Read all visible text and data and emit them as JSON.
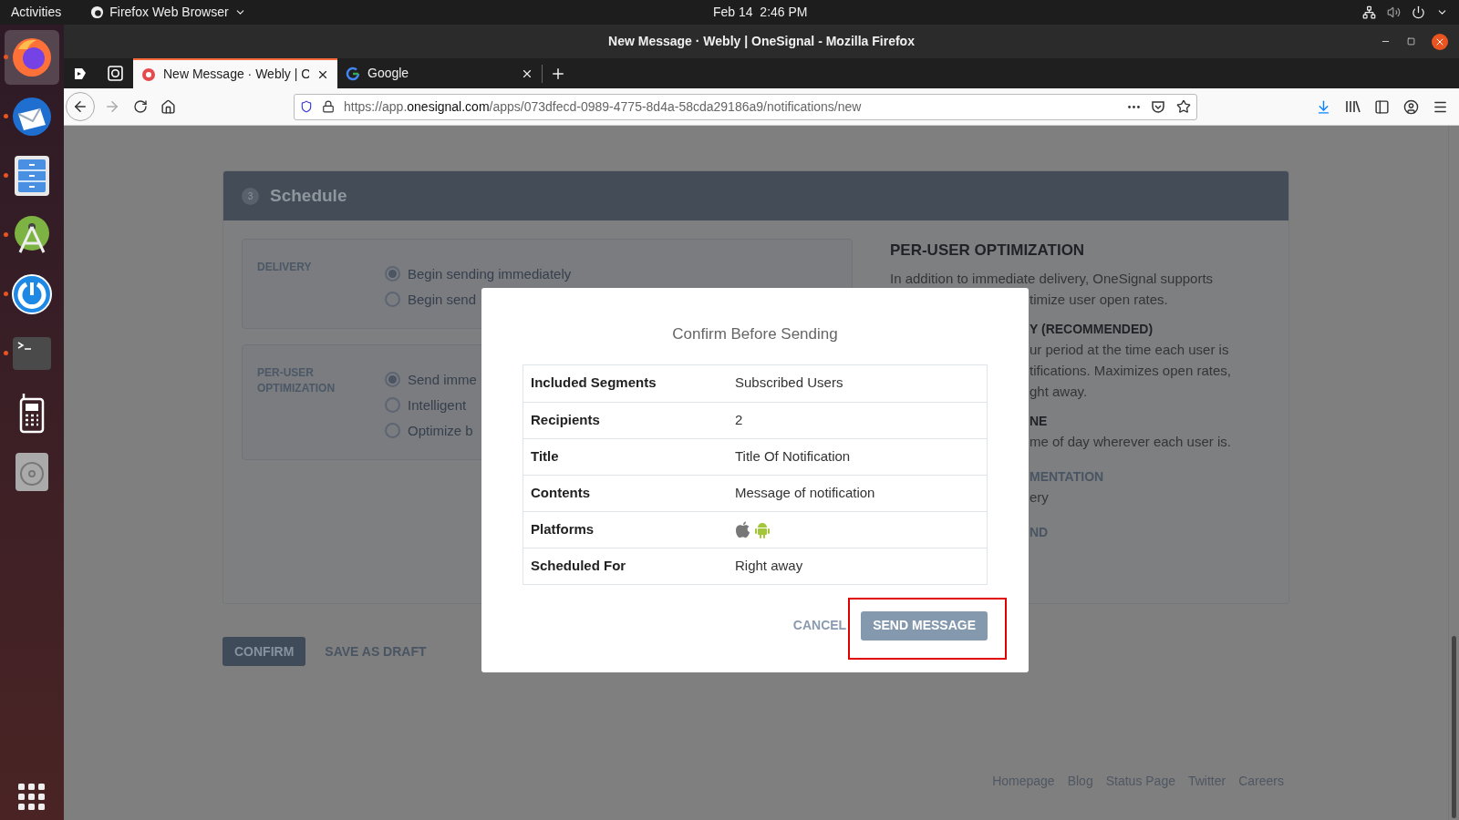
{
  "top_bar": {
    "activities": "Activities",
    "app_menu": "Firefox Web Browser",
    "clock": "Feb 14  2:46 PM"
  },
  "dock": [
    {
      "kind": "firefox",
      "running": true,
      "selected": true
    },
    {
      "kind": "mail",
      "running": true,
      "selected": false
    },
    {
      "kind": "files",
      "running": true,
      "selected": false
    },
    {
      "kind": "studio",
      "running": true,
      "selected": false
    },
    {
      "kind": "chat",
      "running": true,
      "selected": false
    },
    {
      "kind": "terminal",
      "running": true,
      "selected": false
    },
    {
      "kind": "phone",
      "running": false,
      "selected": false
    },
    {
      "kind": "disc",
      "running": false,
      "selected": false
    }
  ],
  "window": {
    "title": "New Message · Webly | OneSignal - Mozilla Firefox"
  },
  "tabs": [
    {
      "kind": "onesignal",
      "label": "New Message · Webly | O",
      "selected": true
    },
    {
      "kind": "google",
      "label": "Google",
      "selected": false
    }
  ],
  "address_bar": {
    "prefix": "https://app.",
    "domain": "onesignal.com",
    "path": "/apps/073dfecd-0989-4775-8d4a-58cda29186a9/notifications/new"
  },
  "schedule": {
    "step": "3",
    "title": "Schedule",
    "sections": [
      {
        "label": "DELIVERY",
        "options": [
          {
            "label": "Begin sending immediately",
            "selected": true
          },
          {
            "label": "Begin send",
            "selected": false
          }
        ]
      },
      {
        "label": "PER-USER OPTIMIZATION",
        "options": [
          {
            "label": "Send imme",
            "selected": true
          },
          {
            "label": "Intelligent",
            "selected": false
          },
          {
            "label": "Optimize b",
            "selected": false
          }
        ]
      }
    ]
  },
  "info_panel": {
    "heading": "PER-USER OPTIMIZATION",
    "intro": "In addition to immediate delivery, OneSignal supports",
    "fragments": [
      {
        "kind": "text",
        "text": "timize user open rates."
      },
      {
        "kind": "subheading",
        "text": "Y (RECOMMENDED)"
      },
      {
        "kind": "text",
        "text": "ur period at the time each user is"
      },
      {
        "kind": "text",
        "text": "tifications. Maximizes open rates,"
      },
      {
        "kind": "text",
        "text": "ght away."
      },
      {
        "kind": "subheading",
        "text": "NE"
      },
      {
        "kind": "text",
        "text": "me of day wherever each user is."
      },
      {
        "kind": "link",
        "text": "MENTATION"
      },
      {
        "kind": "text",
        "text": "ery"
      },
      {
        "kind": "link",
        "text": "ND"
      }
    ]
  },
  "actions": [
    {
      "kind": "primary",
      "label": "CONFIRM"
    },
    {
      "kind": "secondary",
      "label": "SAVE AS DRAFT"
    }
  ],
  "footer_links": [
    "Homepage",
    "Blog",
    "Status Page",
    "Twitter",
    "Careers"
  ],
  "modal": {
    "title": "Confirm Before Sending",
    "rows": [
      {
        "kind": "text",
        "label": "Included Segments",
        "value": "Subscribed Users"
      },
      {
        "kind": "text",
        "label": "Recipients",
        "value": "2"
      },
      {
        "kind": "text",
        "label": "Title",
        "value": "Title Of Notification"
      },
      {
        "kind": "text",
        "label": "Contents",
        "value": "Message of notification"
      },
      {
        "kind": "platforms",
        "label": "Platforms"
      },
      {
        "kind": "text",
        "label": "Scheduled For",
        "value": "Right away"
      }
    ],
    "cancel": "CANCEL",
    "send": "SEND MESSAGE",
    "send_highlighted": true
  }
}
